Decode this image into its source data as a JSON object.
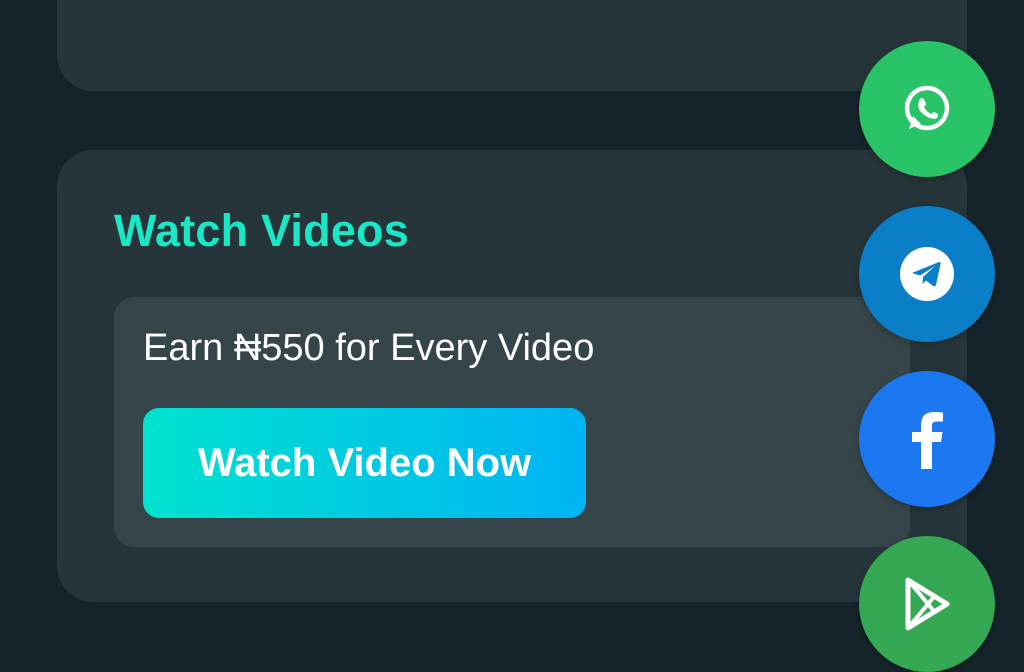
{
  "colors": {
    "page_bg": "#15242a",
    "card_bg": "#263539",
    "inner_bg": "#364549",
    "accent_title": "#19e7c6",
    "button_gradient_start": "#00e2cf",
    "button_gradient_end": "#00b4f4",
    "whatsapp": "#29c467",
    "telegram": "#0a7fc7",
    "facebook": "#1c78f0",
    "play_store": "#34a853"
  },
  "watch_videos": {
    "title": "Watch Videos",
    "offer_text": "Earn ₦550 for Every Video",
    "button_label": "Watch Video Now"
  },
  "social_buttons": [
    {
      "icon": "whatsapp-icon"
    },
    {
      "icon": "telegram-icon"
    },
    {
      "icon": "facebook-icon"
    },
    {
      "icon": "play-store-icon"
    }
  ]
}
